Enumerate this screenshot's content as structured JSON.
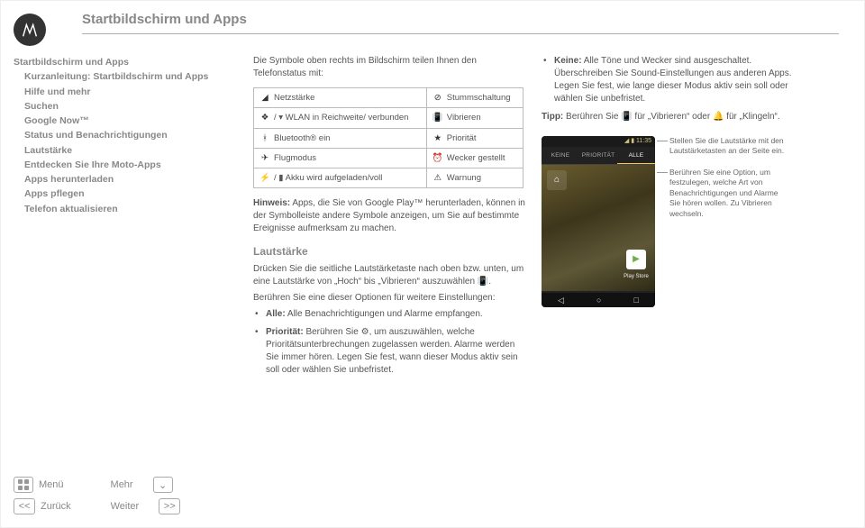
{
  "header": {
    "title": "Startbildschirm und Apps"
  },
  "nav": {
    "title": "Startbildschirm und Apps",
    "items": [
      "Kurzanleitung: Startbildschirm und Apps",
      "Hilfe und mehr",
      "Suchen",
      "Google Now™",
      "Status und Benachrichtigungen",
      "Lautstärke",
      "Entdecken Sie Ihre Moto-Apps",
      "Apps herunterladen",
      "Apps pflegen",
      "Telefon aktualisieren"
    ]
  },
  "midcol": {
    "lead": "Die Symbole oben rechts im Bildschirm teilen Ihnen den Telefonstatus mit:",
    "table": [
      {
        "l_icon": "◢",
        "l": "Netzstärke",
        "r_icon": "⊘",
        "r": "Stummschaltung"
      },
      {
        "l_icon": "❖",
        "l": "/ ▾ WLAN in Reichweite/ verbunden",
        "r_icon": "📳",
        "r": "Vibrieren"
      },
      {
        "l_icon": "ᚼ",
        "l": "Bluetooth® ein",
        "r_icon": "★",
        "r": "Priorität"
      },
      {
        "l_icon": "✈",
        "l": "Flugmodus",
        "r_icon": "⏰",
        "r": "Wecker gestellt"
      },
      {
        "l_icon": "⚡",
        "l": "/ ▮ Akku wird aufgeladen/voll",
        "r_icon": "⚠",
        "r": "Warnung"
      }
    ],
    "hinweis_lbl": "Hinweis:",
    "hinweis": " Apps, die Sie von Google Play™ herunterladen, können in der Symbolleiste andere Symbole anzeigen, um Sie auf bestimmte Ereignisse aufmerksam zu machen.",
    "h2": "Lautstärke",
    "p1": "Drücken Sie die seitliche Lautstärketaste nach oben bzw. unten, um eine Lautstärke von „Hoch“ bis „Vibrieren“ auszuwählen 📳.",
    "p2": "Berühren Sie eine dieser Optionen für weitere Einstellungen:",
    "bullets": {
      "b1_lbl": "Alle:",
      "b1": " Alle Benachrichtigungen und Alarme empfangen.",
      "b2_lbl": "Priorität:",
      "b2": " Berühren Sie ⚙, um auszuwählen, welche Prioritätsunterbrechungen zugelassen werden. Alarme werden Sie immer hören. Legen Sie fest, wann dieser Modus aktiv sein soll oder wählen Sie unbefristet."
    }
  },
  "rightcol": {
    "bul_lbl": "Keine:",
    "bul": " Alle Töne und Wecker sind ausgeschaltet. Überschreiben Sie Sound-Einstellungen aus anderen Apps. Legen Sie fest, wie lange dieser Modus aktiv sein soll oder wählen Sie unbefristet.",
    "tipp_lbl": "Tipp:",
    "tipp": " Berühren Sie 📳 für „Vibrieren“ oder 🔔 für „Klingeln“."
  },
  "phone": {
    "time": "◢ ▮ 11:35",
    "tabs": {
      "a": "KEINE",
      "b": "PRIORITÄT",
      "c": "ALLE"
    },
    "play": "Play Store",
    "keys": {
      "back": "◁",
      "home": "○",
      "recent": "□"
    }
  },
  "callouts": {
    "c1": "Stellen Sie die Lautstärke mit den Lautstärketasten an der Seite ein.",
    "c2": "Berühren Sie eine Option, um festzulegen, welche Art von Benachrichtigungen und Alarme Sie hören wollen. Zu Vibrieren wechseln."
  },
  "bottom": {
    "menu": "Menü",
    "more": "Mehr",
    "back": "Zurück",
    "next": "Weiter",
    "arrow": "⌄",
    "ll": "<<",
    "rr": ">>"
  }
}
